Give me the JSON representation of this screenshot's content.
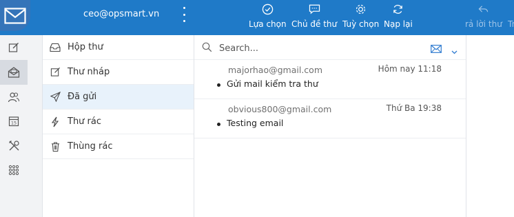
{
  "header": {
    "account": "ceo@opsmart.vn",
    "toolbar": [
      {
        "icon": "check-circle-icon",
        "label": "Lựa chọn"
      },
      {
        "icon": "chat-bubble-icon",
        "label": "Chủ đề thư"
      },
      {
        "icon": "gear-icon",
        "label": "Tuỳ chọn"
      },
      {
        "icon": "refresh-icon",
        "label": "Nạp lại"
      },
      {
        "icon": "reply-icon",
        "label": "rả lời thư",
        "disabled": true
      },
      {
        "icon": "reply-all-icon",
        "label": "Tr",
        "disabled": true
      }
    ]
  },
  "rail": [
    {
      "icon": "compose-icon"
    },
    {
      "icon": "mail-icon",
      "active": true
    },
    {
      "icon": "contacts-icon"
    },
    {
      "icon": "calendar-icon",
      "day": "15"
    },
    {
      "icon": "tools-icon"
    },
    {
      "icon": "apps-grid-icon"
    }
  ],
  "folders": [
    {
      "icon": "inbox-icon",
      "label": "Hộp thư"
    },
    {
      "icon": "drafts-icon",
      "label": "Thư nháp"
    },
    {
      "icon": "sent-icon",
      "label": "Đã gửi",
      "active": true
    },
    {
      "icon": "spam-icon",
      "label": "Thư rác"
    },
    {
      "icon": "trash-icon",
      "label": "Thùng rác"
    }
  ],
  "search": {
    "placeholder": "Search..."
  },
  "messages": [
    {
      "from": "majorhao@gmail.com",
      "time": "Hôm nay 11:18",
      "subject": "Gửi mail kiểm tra thư"
    },
    {
      "from": "obvious800@gmail.com",
      "time": "Thứ Ba 19:38",
      "subject": "Testing email"
    }
  ],
  "colors": {
    "header": "#1f7ac8",
    "logo_bg": "#3574b9",
    "active_folder": "#e8f2fb",
    "rail_bg": "#f2f3f5"
  }
}
